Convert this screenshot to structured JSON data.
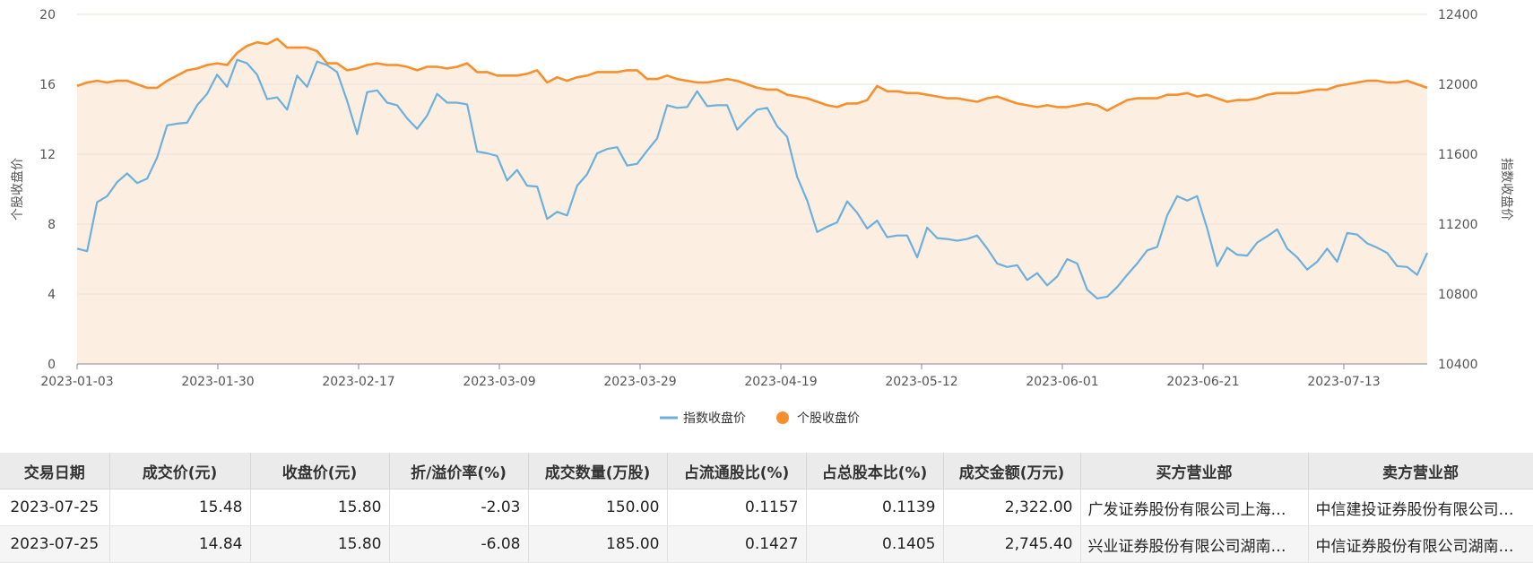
{
  "chart_data": {
    "type": "line",
    "left_axis": {
      "label": "个股收盘价",
      "ylim": [
        0,
        20
      ],
      "ticks": [
        "0",
        "4",
        "8",
        "12",
        "16",
        "20"
      ]
    },
    "right_axis": {
      "label": "指数收盘价",
      "ylim": [
        10400,
        12400
      ],
      "ticks": [
        "10400",
        "10800",
        "11200",
        "11600",
        "12000",
        "12400"
      ]
    },
    "x_tick_labels": [
      "2023-01-03",
      "2023-01-30",
      "2023-02-17",
      "2023-03-09",
      "2023-03-29",
      "2023-04-19",
      "2023-05-12",
      "2023-06-01",
      "2023-06-21",
      "2023-07-13"
    ],
    "legend": [
      {
        "name": "指数收盘价",
        "color": "#6cb0dc",
        "marker": "line"
      },
      {
        "name": "个股收盘价",
        "color": "#f7902c",
        "marker": "circle"
      }
    ],
    "series": [
      {
        "name": "指数收盘价",
        "axis": "right",
        "color": "#6cb0dc",
        "values": [
          11060,
          11045,
          11325,
          11360,
          11440,
          11490,
          11435,
          11460,
          11580,
          11765,
          11775,
          11780,
          11880,
          11945,
          12055,
          11985,
          12140,
          12120,
          12055,
          11915,
          11925,
          11855,
          12050,
          11985,
          12130,
          12110,
          12070,
          11905,
          11715,
          11955,
          11965,
          11895,
          11880,
          11805,
          11745,
          11820,
          11945,
          11895,
          11895,
          11885,
          11615,
          11605,
          11590,
          11450,
          11510,
          11420,
          11415,
          11230,
          11270,
          11250,
          11420,
          11485,
          11605,
          11630,
          11640,
          11535,
          11545,
          11620,
          11690,
          11880,
          11865,
          11870,
          11960,
          11875,
          11880,
          11880,
          11740,
          11800,
          11855,
          11865,
          11760,
          11700,
          11470,
          11335,
          11155,
          11185,
          11210,
          11330,
          11265,
          11175,
          11220,
          11125,
          11135,
          11135,
          11010,
          11180,
          11120,
          11115,
          11105,
          11115,
          11135,
          11060,
          10975,
          10955,
          10965,
          10880,
          10920,
          10850,
          10900,
          11000,
          10975,
          10825,
          10775,
          10785,
          10840,
          10910,
          10975,
          11050,
          11070,
          11250,
          11360,
          11335,
          11360,
          11175,
          10960,
          11065,
          11025,
          11020,
          11095,
          11130,
          11170,
          11060,
          11010,
          10940,
          10985,
          11060,
          10985,
          11150,
          11140,
          11090,
          11065,
          11035,
          10960,
          10955,
          10910,
          11035
        ]
      },
      {
        "name": "个股收盘价",
        "axis": "left",
        "color": "#f7902c",
        "values": [
          15.9,
          16.1,
          16.2,
          16.1,
          16.2,
          16.2,
          16.0,
          15.8,
          15.8,
          16.2,
          16.5,
          16.8,
          16.9,
          17.1,
          17.2,
          17.1,
          17.8,
          18.2,
          18.4,
          18.3,
          18.6,
          18.1,
          18.1,
          18.1,
          17.9,
          17.2,
          17.2,
          16.8,
          16.9,
          17.1,
          17.2,
          17.1,
          17.1,
          17.0,
          16.8,
          17.0,
          17.0,
          16.9,
          17.0,
          17.2,
          16.7,
          16.7,
          16.5,
          16.5,
          16.5,
          16.6,
          16.8,
          16.1,
          16.4,
          16.2,
          16.4,
          16.5,
          16.7,
          16.7,
          16.7,
          16.8,
          16.8,
          16.3,
          16.3,
          16.5,
          16.3,
          16.2,
          16.1,
          16.1,
          16.2,
          16.3,
          16.2,
          16.0,
          15.8,
          15.7,
          15.7,
          15.4,
          15.3,
          15.2,
          15.0,
          14.8,
          14.7,
          14.9,
          14.9,
          15.1,
          15.9,
          15.6,
          15.6,
          15.5,
          15.5,
          15.4,
          15.3,
          15.2,
          15.2,
          15.1,
          15.0,
          15.2,
          15.3,
          15.1,
          14.9,
          14.8,
          14.7,
          14.8,
          14.7,
          14.7,
          14.8,
          14.9,
          14.8,
          14.5,
          14.8,
          15.1,
          15.2,
          15.2,
          15.2,
          15.4,
          15.4,
          15.5,
          15.3,
          15.4,
          15.2,
          15.0,
          15.1,
          15.1,
          15.2,
          15.4,
          15.5,
          15.5,
          15.5,
          15.6,
          15.7,
          15.7,
          15.9,
          16.0,
          16.1,
          16.2,
          16.2,
          16.1,
          16.1,
          16.2,
          16.0,
          15.8
        ]
      }
    ]
  },
  "table": {
    "columns": [
      "交易日期",
      "成交价(元)",
      "收盘价(元)",
      "折/溢价率(%)",
      "成交数量(万股)",
      "占流通股比(%)",
      "占总股本比(%)",
      "成交金额(万元)",
      "买方营业部",
      "卖方营业部"
    ],
    "rows": [
      [
        "2023-07-25",
        "15.48",
        "15.80",
        "-2.03",
        "150.00",
        "0.1157",
        "0.1139",
        "2,322.00",
        "广发证券股份有限公司上海…",
        "中信建投证券股份有限公司…"
      ],
      [
        "2023-07-25",
        "14.84",
        "15.80",
        "-6.08",
        "185.00",
        "0.1427",
        "0.1405",
        "2,745.40",
        "兴业证券股份有限公司湖南…",
        "中信证券股份有限公司湖南…"
      ]
    ]
  }
}
